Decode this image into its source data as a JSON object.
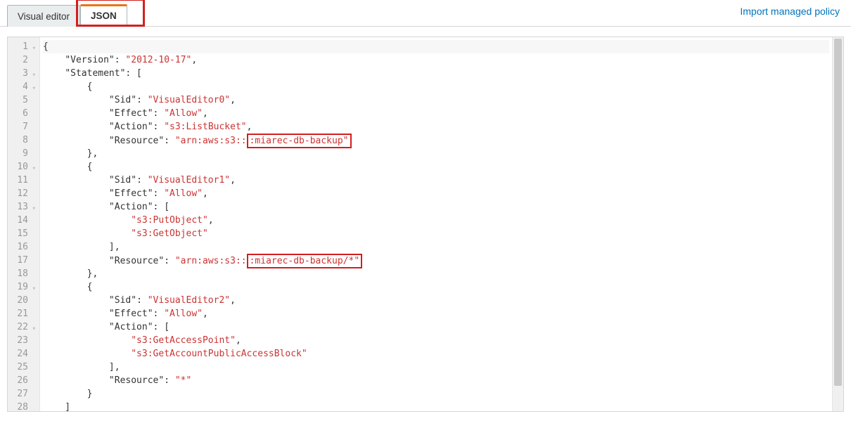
{
  "tabs": {
    "visual_editor": "Visual editor",
    "json": "JSON"
  },
  "import_link": "Import managed policy",
  "code_lines": [
    {
      "n": 1,
      "fold": true,
      "active": true,
      "segs": [
        {
          "t": "{",
          "c": "pun"
        }
      ]
    },
    {
      "n": 2,
      "fold": false,
      "segs": [
        {
          "t": "    ",
          "c": "pun"
        },
        {
          "t": "\"Version\"",
          "c": "key"
        },
        {
          "t": ": ",
          "c": "pun"
        },
        {
          "t": "\"2012-10-17\"",
          "c": "str"
        },
        {
          "t": ",",
          "c": "pun"
        }
      ]
    },
    {
      "n": 3,
      "fold": true,
      "segs": [
        {
          "t": "    ",
          "c": "pun"
        },
        {
          "t": "\"Statement\"",
          "c": "key"
        },
        {
          "t": ": [",
          "c": "pun"
        }
      ]
    },
    {
      "n": 4,
      "fold": true,
      "segs": [
        {
          "t": "        {",
          "c": "pun"
        }
      ]
    },
    {
      "n": 5,
      "fold": false,
      "segs": [
        {
          "t": "            ",
          "c": "pun"
        },
        {
          "t": "\"Sid\"",
          "c": "key"
        },
        {
          "t": ": ",
          "c": "pun"
        },
        {
          "t": "\"VisualEditor0\"",
          "c": "str"
        },
        {
          "t": ",",
          "c": "pun"
        }
      ]
    },
    {
      "n": 6,
      "fold": false,
      "segs": [
        {
          "t": "            ",
          "c": "pun"
        },
        {
          "t": "\"Effect\"",
          "c": "key"
        },
        {
          "t": ": ",
          "c": "pun"
        },
        {
          "t": "\"Allow\"",
          "c": "str"
        },
        {
          "t": ",",
          "c": "pun"
        }
      ]
    },
    {
      "n": 7,
      "fold": false,
      "segs": [
        {
          "t": "            ",
          "c": "pun"
        },
        {
          "t": "\"Action\"",
          "c": "key"
        },
        {
          "t": ": ",
          "c": "pun"
        },
        {
          "t": "\"s3:ListBucket\"",
          "c": "str"
        },
        {
          "t": ",",
          "c": "pun"
        }
      ]
    },
    {
      "n": 8,
      "fold": false,
      "segs": [
        {
          "t": "            ",
          "c": "pun"
        },
        {
          "t": "\"Resource\"",
          "c": "key"
        },
        {
          "t": ": ",
          "c": "pun"
        },
        {
          "t": "\"arn:aws:s3::",
          "c": "str"
        },
        {
          "t": ":miarec-db-backup\"",
          "c": "str",
          "box": true
        }
      ]
    },
    {
      "n": 9,
      "fold": false,
      "segs": [
        {
          "t": "        },",
          "c": "pun"
        }
      ]
    },
    {
      "n": 10,
      "fold": true,
      "segs": [
        {
          "t": "        {",
          "c": "pun"
        }
      ]
    },
    {
      "n": 11,
      "fold": false,
      "segs": [
        {
          "t": "            ",
          "c": "pun"
        },
        {
          "t": "\"Sid\"",
          "c": "key"
        },
        {
          "t": ": ",
          "c": "pun"
        },
        {
          "t": "\"VisualEditor1\"",
          "c": "str"
        },
        {
          "t": ",",
          "c": "pun"
        }
      ]
    },
    {
      "n": 12,
      "fold": false,
      "segs": [
        {
          "t": "            ",
          "c": "pun"
        },
        {
          "t": "\"Effect\"",
          "c": "key"
        },
        {
          "t": ": ",
          "c": "pun"
        },
        {
          "t": "\"Allow\"",
          "c": "str"
        },
        {
          "t": ",",
          "c": "pun"
        }
      ]
    },
    {
      "n": 13,
      "fold": true,
      "segs": [
        {
          "t": "            ",
          "c": "pun"
        },
        {
          "t": "\"Action\"",
          "c": "key"
        },
        {
          "t": ": [",
          "c": "pun"
        }
      ]
    },
    {
      "n": 14,
      "fold": false,
      "segs": [
        {
          "t": "                ",
          "c": "pun"
        },
        {
          "t": "\"s3:PutObject\"",
          "c": "str"
        },
        {
          "t": ",",
          "c": "pun"
        }
      ]
    },
    {
      "n": 15,
      "fold": false,
      "segs": [
        {
          "t": "                ",
          "c": "pun"
        },
        {
          "t": "\"s3:GetObject\"",
          "c": "str"
        }
      ]
    },
    {
      "n": 16,
      "fold": false,
      "segs": [
        {
          "t": "            ],",
          "c": "pun"
        }
      ]
    },
    {
      "n": 17,
      "fold": false,
      "segs": [
        {
          "t": "            ",
          "c": "pun"
        },
        {
          "t": "\"Resource\"",
          "c": "key"
        },
        {
          "t": ": ",
          "c": "pun"
        },
        {
          "t": "\"arn:aws:s3::",
          "c": "str"
        },
        {
          "t": ":miarec-db-backup/*\"",
          "c": "str",
          "box": true
        }
      ]
    },
    {
      "n": 18,
      "fold": false,
      "segs": [
        {
          "t": "        },",
          "c": "pun"
        }
      ]
    },
    {
      "n": 19,
      "fold": true,
      "segs": [
        {
          "t": "        {",
          "c": "pun"
        }
      ]
    },
    {
      "n": 20,
      "fold": false,
      "segs": [
        {
          "t": "            ",
          "c": "pun"
        },
        {
          "t": "\"Sid\"",
          "c": "key"
        },
        {
          "t": ": ",
          "c": "pun"
        },
        {
          "t": "\"VisualEditor2\"",
          "c": "str"
        },
        {
          "t": ",",
          "c": "pun"
        }
      ]
    },
    {
      "n": 21,
      "fold": false,
      "segs": [
        {
          "t": "            ",
          "c": "pun"
        },
        {
          "t": "\"Effect\"",
          "c": "key"
        },
        {
          "t": ": ",
          "c": "pun"
        },
        {
          "t": "\"Allow\"",
          "c": "str"
        },
        {
          "t": ",",
          "c": "pun"
        }
      ]
    },
    {
      "n": 22,
      "fold": true,
      "segs": [
        {
          "t": "            ",
          "c": "pun"
        },
        {
          "t": "\"Action\"",
          "c": "key"
        },
        {
          "t": ": [",
          "c": "pun"
        }
      ]
    },
    {
      "n": 23,
      "fold": false,
      "segs": [
        {
          "t": "                ",
          "c": "pun"
        },
        {
          "t": "\"s3:GetAccessPoint\"",
          "c": "str"
        },
        {
          "t": ",",
          "c": "pun"
        }
      ]
    },
    {
      "n": 24,
      "fold": false,
      "segs": [
        {
          "t": "                ",
          "c": "pun"
        },
        {
          "t": "\"s3:GetAccountPublicAccessBlock\"",
          "c": "str"
        }
      ]
    },
    {
      "n": 25,
      "fold": false,
      "segs": [
        {
          "t": "            ],",
          "c": "pun"
        }
      ]
    },
    {
      "n": 26,
      "fold": false,
      "segs": [
        {
          "t": "            ",
          "c": "pun"
        },
        {
          "t": "\"Resource\"",
          "c": "key"
        },
        {
          "t": ": ",
          "c": "pun"
        },
        {
          "t": "\"*\"",
          "c": "str"
        }
      ]
    },
    {
      "n": 27,
      "fold": false,
      "segs": [
        {
          "t": "        }",
          "c": "pun"
        }
      ]
    },
    {
      "n": 28,
      "fold": false,
      "segs": [
        {
          "t": "    ]",
          "c": "pun"
        }
      ]
    }
  ]
}
